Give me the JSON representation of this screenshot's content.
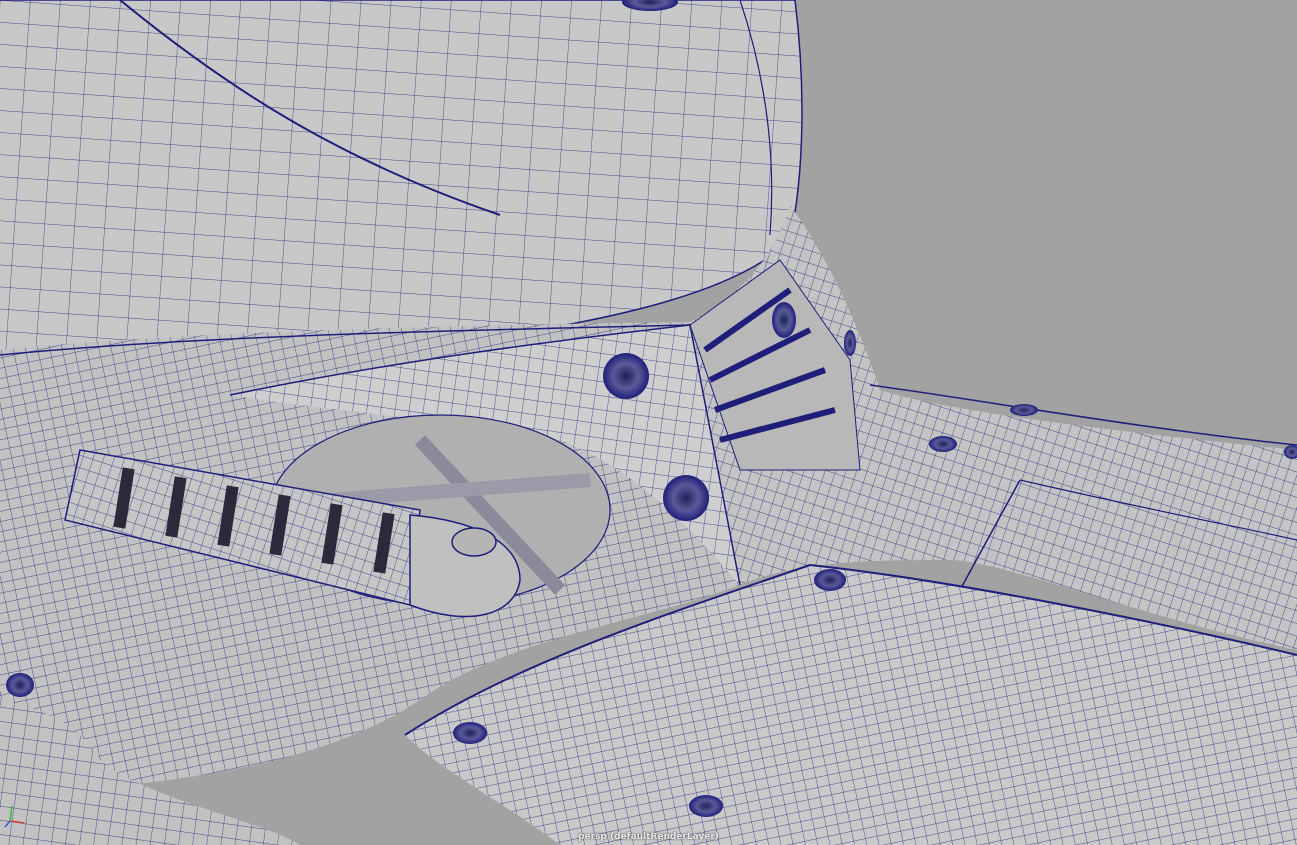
{
  "viewport": {
    "camera_label": "persp (defaultRenderLayer)",
    "background_color": "#a2a2a2",
    "mesh_color": "#c7c7c7",
    "wire_color": "#1f1f7a"
  },
  "gizmo": {
    "icon": "xyz-axis-icon",
    "colors": {
      "x": "#d23a2a",
      "y": "#39c23a",
      "z": "#3a5ee0"
    }
  }
}
